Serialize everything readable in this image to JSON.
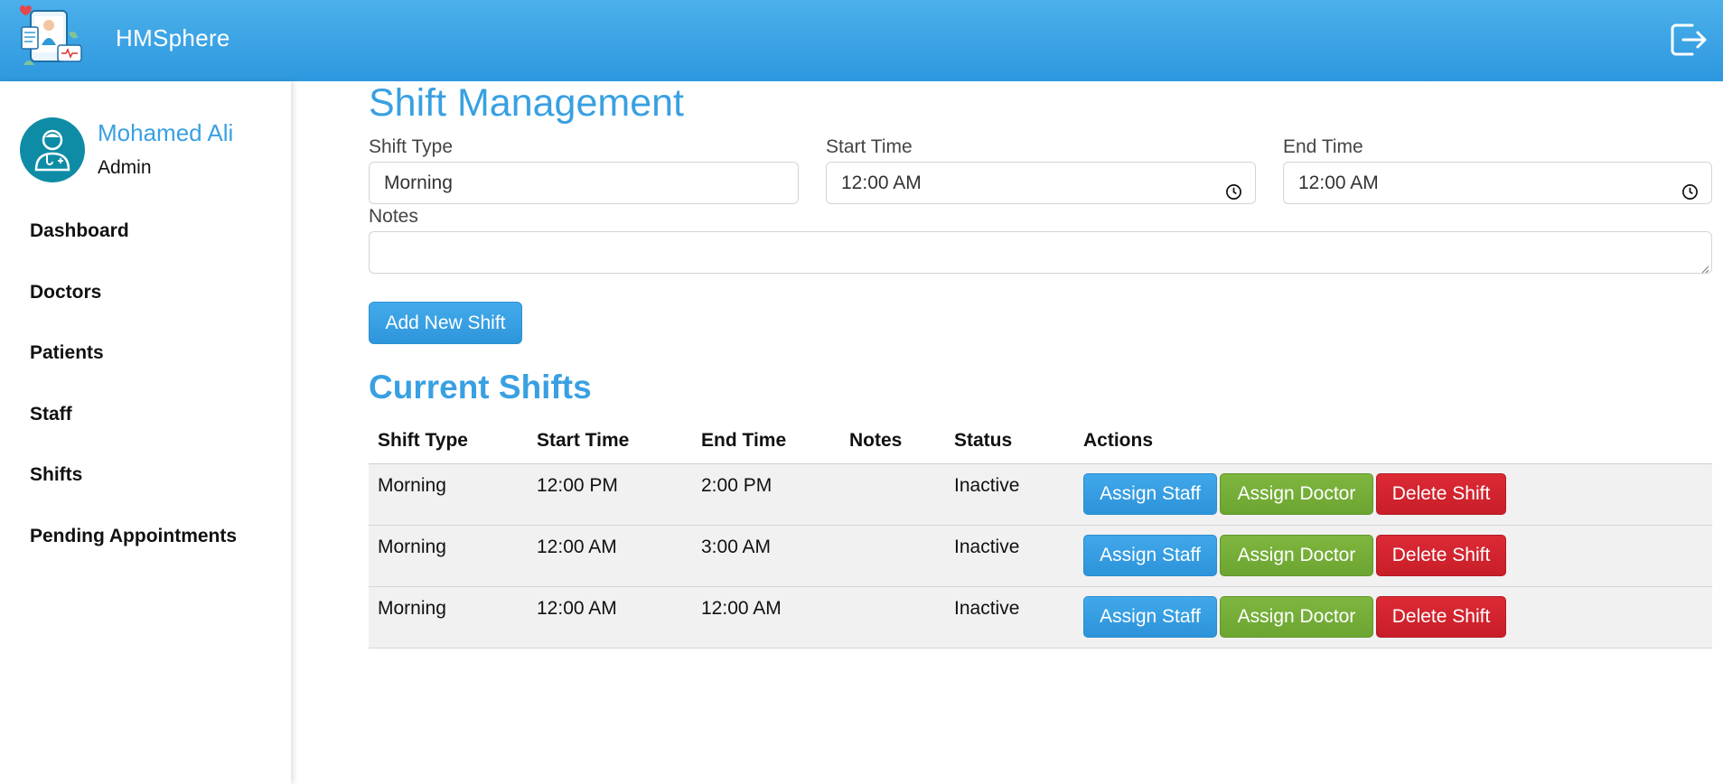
{
  "app": {
    "brand": "HMSphere"
  },
  "user": {
    "name": "Mohamed Ali",
    "role": "Admin"
  },
  "nav": {
    "items": [
      {
        "label": "Dashboard"
      },
      {
        "label": "Doctors"
      },
      {
        "label": "Patients"
      },
      {
        "label": "Staff"
      },
      {
        "label": "Shifts"
      },
      {
        "label": "Pending Appointments"
      }
    ]
  },
  "form": {
    "title": "Shift Management",
    "shift_type": {
      "label": "Shift Type",
      "value": "Morning"
    },
    "start_time": {
      "label": "Start Time",
      "value": "12:00  AM"
    },
    "end_time": {
      "label": "End Time",
      "value": "12:00  AM"
    },
    "notes": {
      "label": "Notes",
      "value": ""
    },
    "submit_label": "Add New Shift"
  },
  "shifts": {
    "title": "Current Shifts",
    "columns": [
      "Shift Type",
      "Start Time",
      "End Time",
      "Notes",
      "Status",
      "Actions"
    ],
    "rows": [
      {
        "shift_type": "Morning",
        "start": "12:00 PM",
        "end": "2:00 PM",
        "notes": "",
        "status": "Inactive"
      },
      {
        "shift_type": "Morning",
        "start": "12:00 AM",
        "end": "3:00 AM",
        "notes": "",
        "status": "Inactive"
      },
      {
        "shift_type": "Morning",
        "start": "12:00 AM",
        "end": "12:00 AM",
        "notes": "",
        "status": "Inactive"
      }
    ],
    "actions": {
      "assign_staff": "Assign Staff",
      "assign_doctor": "Assign Doctor",
      "delete": "Delete Shift"
    }
  },
  "colors": {
    "header": "#2e98df",
    "accent": "#39a0e2",
    "assign_staff": "#2d93da",
    "assign_doctor": "#6ca531",
    "delete": "#c81e28",
    "row_bg": "#f1f1f1"
  },
  "icons": {
    "logo": "medical-app-logo-icon",
    "logout": "logout-icon",
    "avatar": "doctor-avatar-icon",
    "clock": "clock-icon"
  }
}
